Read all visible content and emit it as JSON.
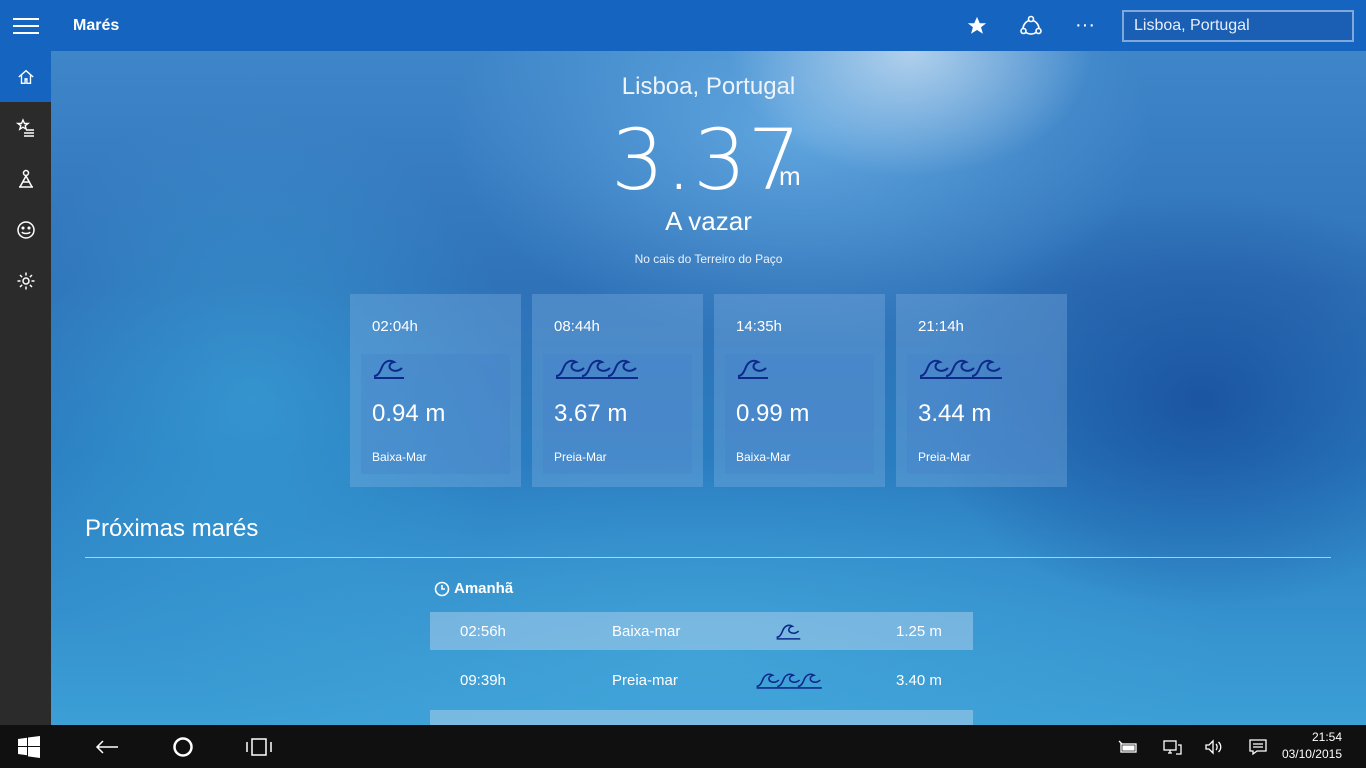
{
  "app": {
    "title": "Marés"
  },
  "toolbar": {
    "favorite_icon": "star-icon",
    "share_icon": "share-icon",
    "more_label": "···"
  },
  "search": {
    "value": "Lisboa, Portugal"
  },
  "sidebar": {
    "items": [
      {
        "icon": "home-icon",
        "active": true
      },
      {
        "icon": "favorites-list-icon"
      },
      {
        "icon": "person-icon"
      },
      {
        "icon": "smiley-icon"
      },
      {
        "icon": "settings-icon"
      }
    ]
  },
  "current": {
    "location": "Lisboa, Portugal",
    "level": "3.37",
    "unit": "m",
    "status": "A vazar",
    "place": "No cais do Terreiro do Paço"
  },
  "today": [
    {
      "time": "02:04h",
      "height": "0.94 m",
      "type": "Baixa-Mar",
      "icon": "small-wave-icon"
    },
    {
      "time": "08:44h",
      "height": "3.67 m",
      "type": "Preia-Mar",
      "icon": "big-wave-icon"
    },
    {
      "time": "14:35h",
      "height": "0.99 m",
      "type": "Baixa-Mar",
      "icon": "small-wave-icon"
    },
    {
      "time": "21:14h",
      "height": "3.44 m",
      "type": "Preia-Mar",
      "icon": "big-wave-icon"
    }
  ],
  "next": {
    "title": "Próximas marés",
    "day": "Amanhã",
    "rows": [
      {
        "time": "02:56h",
        "type": "Baixa-mar",
        "height": "1.25 m",
        "icon": "small-wave-icon"
      },
      {
        "time": "09:39h",
        "type": "Preia-mar",
        "height": "3.40 m",
        "icon": "big-wave-icon"
      }
    ]
  },
  "taskbar": {
    "time": "21:54",
    "date": "03/10/2015"
  },
  "colors": {
    "accent": "#1565c0",
    "sidebar": "#2b2b2b",
    "wave": "#0d2a8a"
  }
}
